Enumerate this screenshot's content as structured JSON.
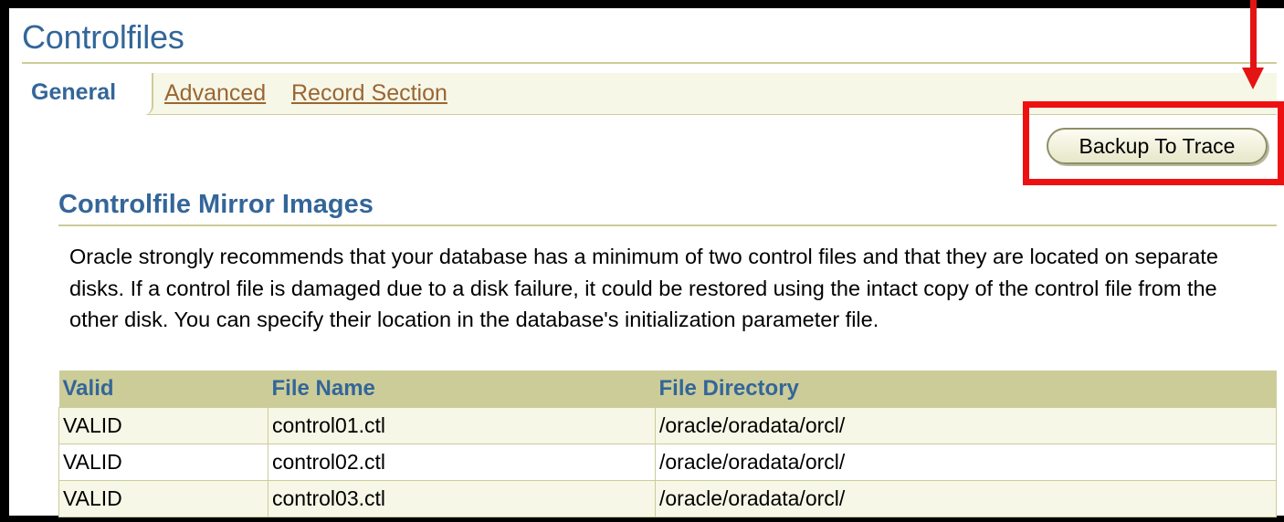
{
  "page": {
    "title": "Controlfiles"
  },
  "tabs": [
    {
      "label": "General",
      "selected": true
    },
    {
      "label": "Advanced",
      "selected": false
    },
    {
      "label": "Record Section",
      "selected": false
    }
  ],
  "actions": {
    "backup_label": "Backup To Trace"
  },
  "section": {
    "title": "Controlfile Mirror Images",
    "description": "Oracle strongly recommends that your database has a minimum of two control files and that they are located on separate disks. If a control file is damaged due to a disk failure, it could be restored using the intact copy of the control file from the other disk. You can specify their location in the database's initialization parameter file."
  },
  "table": {
    "headers": [
      "Valid",
      "File Name",
      "File Directory"
    ],
    "rows": [
      [
        "VALID",
        "control01.ctl",
        "/oracle/oradata/orcl/"
      ],
      [
        "VALID",
        "control02.ctl",
        "/oracle/oradata/orcl/"
      ],
      [
        "VALID",
        "control03.ctl",
        "/oracle/oradata/orcl/"
      ]
    ]
  },
  "colors": {
    "accent_blue": "#336699",
    "link_brown": "#996633",
    "header_tan": "#cccc99",
    "highlight_red": "#ee1111"
  }
}
